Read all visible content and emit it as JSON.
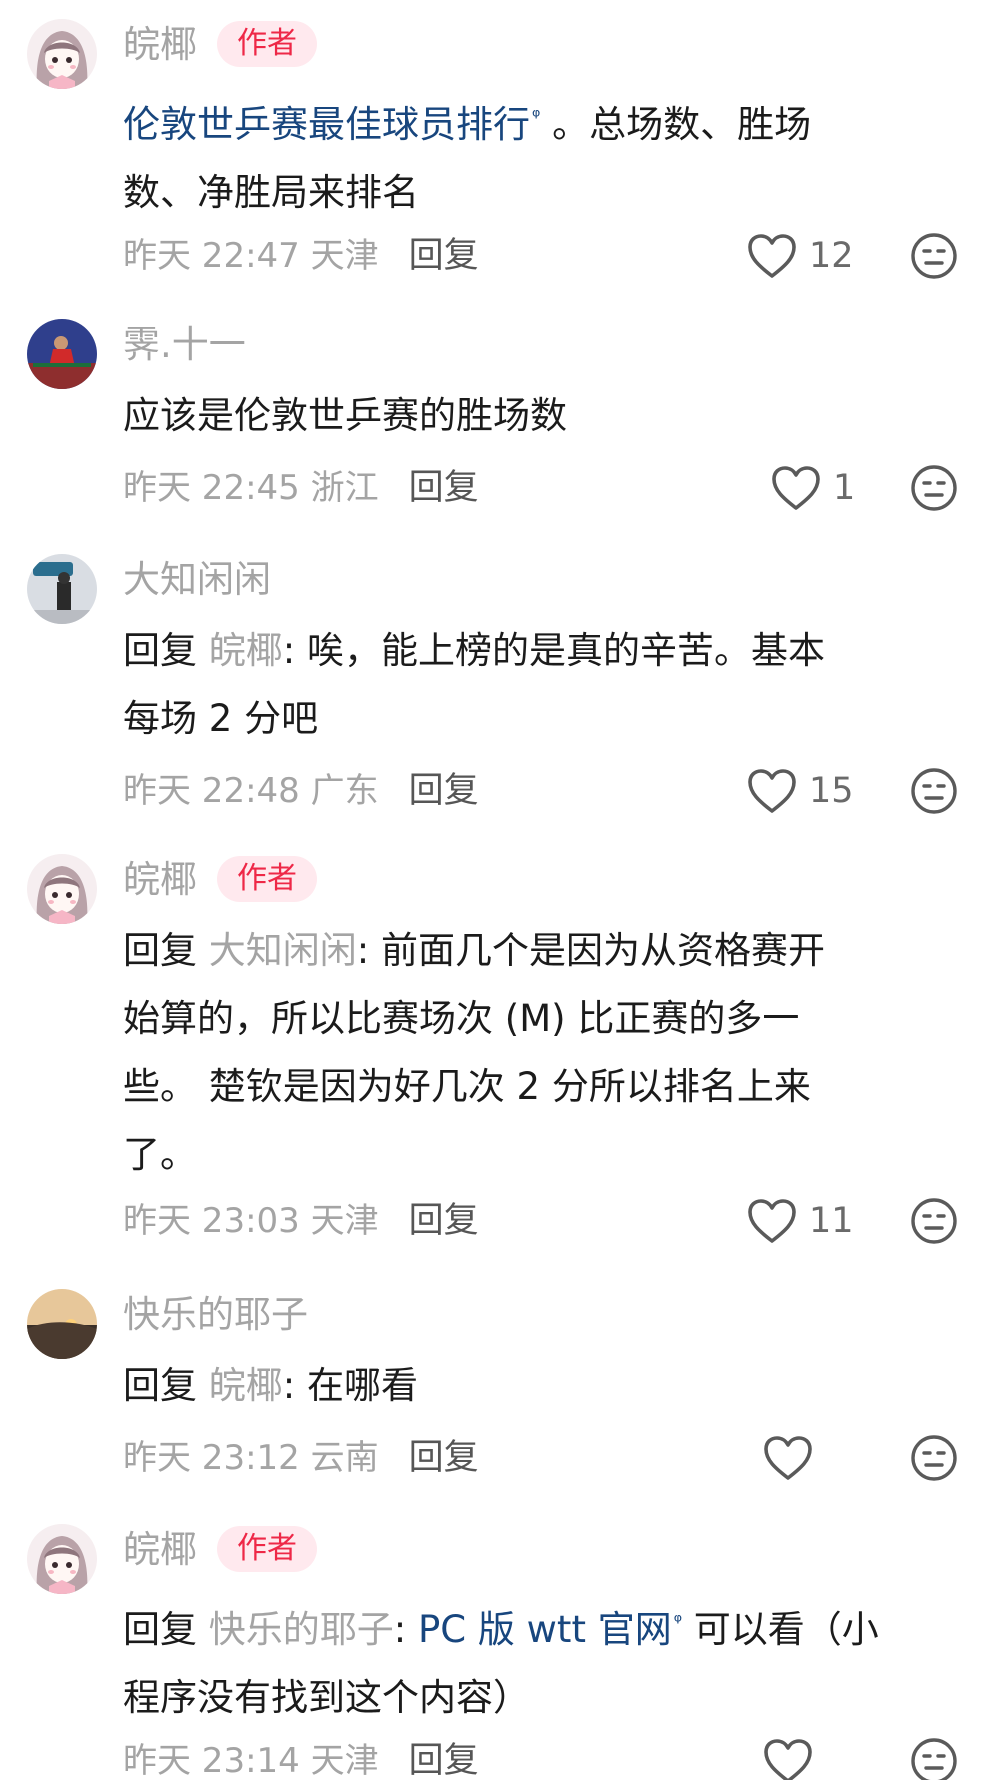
{
  "comments": [
    {
      "username": "皖椰",
      "author_badge": "作者",
      "link_text": "伦敦世乒赛最佳球员排行",
      "link_mark": "ᵠ",
      "text_line1": " 。总场数、胜场",
      "text_line2": "数、净胜局来排名",
      "time": "昨天 22:47",
      "location": "天津",
      "reply_label": "回复",
      "likes": "12"
    },
    {
      "username": "霁.十一",
      "text": "应该是伦敦世乒赛的胜场数",
      "time": "昨天 22:45",
      "location": "浙江",
      "reply_label": "回复",
      "likes": "1"
    },
    {
      "username": "大知闲闲",
      "reply_prefix": "回复",
      "mention": "皖椰",
      "text_line1": ": 唉，能上榜的是真的辛苦。基本",
      "text_line2": "每场 2 分吧",
      "time": "昨天 22:48",
      "location": "广东",
      "reply_label": "回复",
      "likes": "15"
    },
    {
      "username": "皖椰",
      "author_badge": "作者",
      "reply_prefix": "回复",
      "mention": "大知闲闲",
      "text_line1": ": 前面几个是因为从资格赛开",
      "text_line2": "始算的，所以比赛场次 (M) 比正赛的多一",
      "text_line3": "些。 楚钦是因为好几次 2 分所以排名上来",
      "text_line4": "了。",
      "time": "昨天 23:03",
      "location": "天津",
      "reply_label": "回复",
      "likes": "11"
    },
    {
      "username": "快乐的耶子",
      "reply_prefix": "回复",
      "mention": "皖椰",
      "text_line1": ": 在哪看",
      "time": "昨天 23:12",
      "location": "云南",
      "reply_label": "回复",
      "likes": ""
    },
    {
      "username": "皖椰",
      "author_badge": "作者",
      "reply_prefix": "回复",
      "mention": "快乐的耶子",
      "colon": ": ",
      "link_text": "PC 版 wtt 官网",
      "link_mark": "ᵠ",
      "text_line1": " 可以看（小",
      "text_line2": "程序没有找到这个内容）",
      "time": "昨天 23:14",
      "location": "天津",
      "reply_label": "回复",
      "likes": ""
    }
  ],
  "colors": {
    "username": "#a4a4a4",
    "badge_bg": "#ffe9ee",
    "badge_text": "#ee2847",
    "link": "#18467e",
    "body_text": "#1b1b1b",
    "icon": "#5a5a5a"
  },
  "icons": [
    "heart-outline-icon",
    "neutral-face-icon"
  ]
}
